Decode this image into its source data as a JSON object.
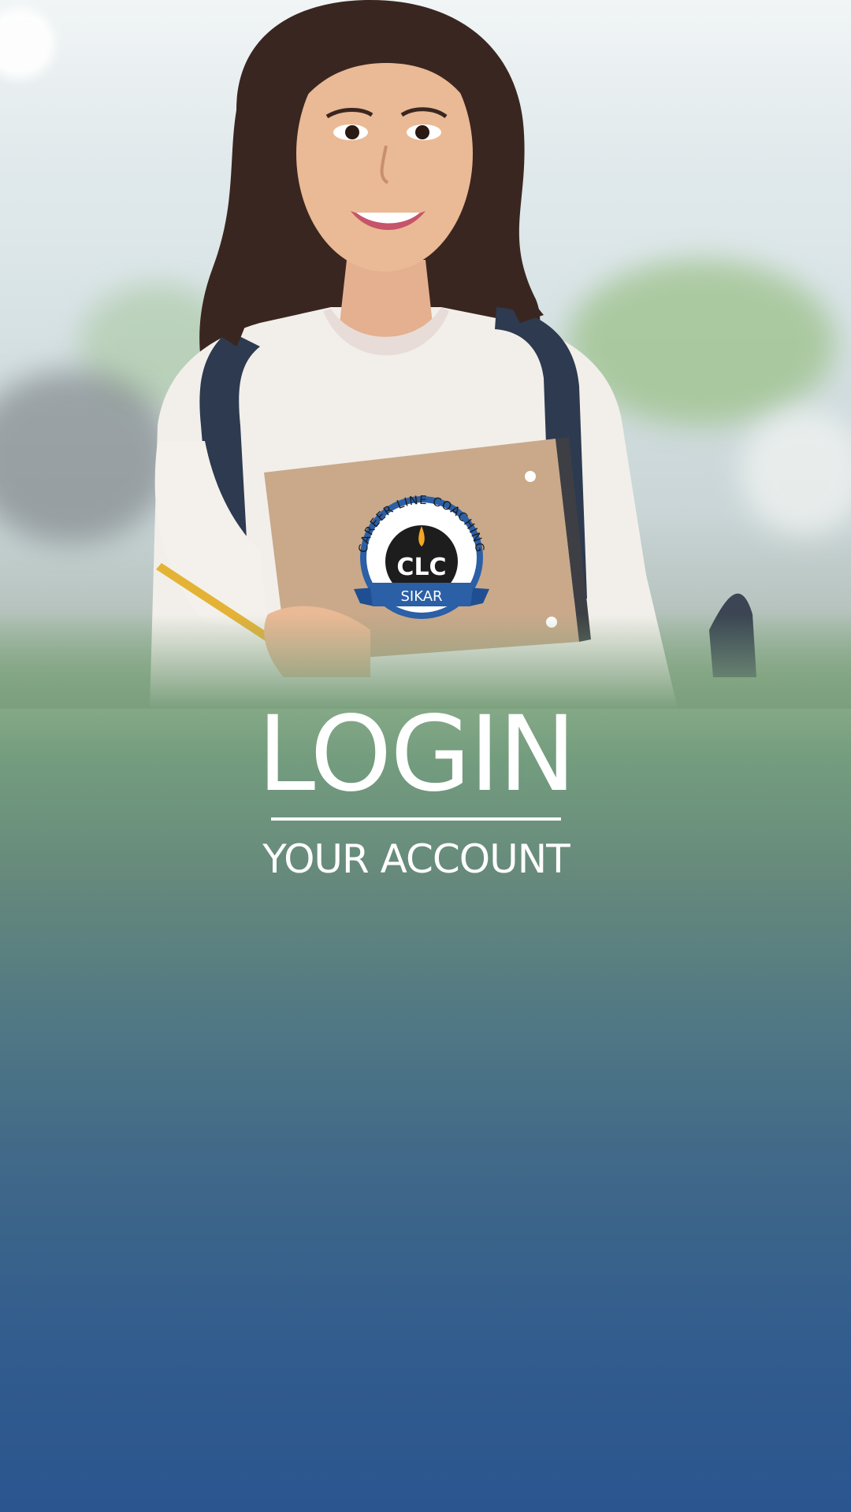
{
  "screen": {
    "background_top": "#e6eef0",
    "background_mid": "#749d7e",
    "background_bottom": "#2a558f"
  },
  "logo": {
    "arc_text": "CAREER LINE COACHING",
    "initials": "CLC",
    "ribbon_text": "SIKAR",
    "brand_color": "#2b5fa6"
  },
  "login": {
    "title": "LOGIN",
    "subtitle": "YOUR ACCOUNT"
  }
}
